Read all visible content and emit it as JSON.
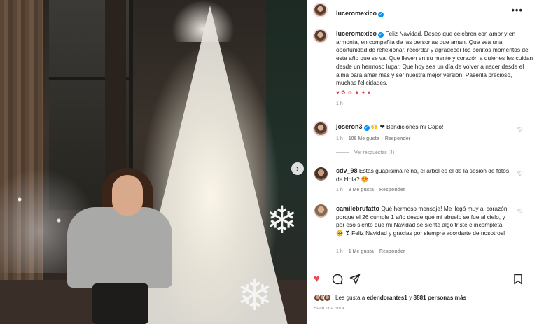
{
  "post_author": {
    "username": "luceromexico",
    "more_label": "•••"
  },
  "caption": {
    "username": "luceromexico",
    "text": "Feliz Navidad. Deseo que celebren con amor y en armonía, en compañía de las personas que aman. Que sea una oportunidad de reflexionar, recordar y agradecer los bonitos momentos de este año que se va. Que lleven en su mente y corazón a quienes les cuidan desde un hermoso lugar. Que hoy sea un día de volver a nacer desde el alma para amar más y ser nuestra mejor versión. Pásenla precioso, muchas felicidades.",
    "emojis": "♥ ✿ ☺ ★ ✦ ♥",
    "time": "1 h"
  },
  "comments": [
    {
      "username": "joseron3",
      "text": "🙌 ❤ Bendiciones mi Capo!",
      "time": "1 h",
      "likes": "108 Me gusta",
      "reply": "Responder",
      "view_replies": "Ver respuestas (4)"
    },
    {
      "username": "cdv_98",
      "text": "Estás guapísima reina, el árbol es el de la sesión de fotos de Hola? 😍",
      "time": "1 h",
      "likes": "3 Me gusta",
      "reply": "Responder"
    },
    {
      "username": "camilebrufatto",
      "text": "Qué hermoso mensaje! Me llegó muy al corazón porque el 26 cumple 1 año desde que mi abuelo se fue al cielo, y por eso siento que mi Navidad se siente algo triste e incompleta 🥺 ❣ Feliz Navidad y gracias por siempre acordarte de nosotros!",
      "time": "1 h",
      "likes": "1 Me gusta",
      "reply": "Responder"
    }
  ],
  "actions": {
    "like_icon": "heart-filled-icon",
    "comment_icon": "comment-icon",
    "share_icon": "share-icon",
    "save_icon": "bookmark-icon",
    "accent_color": "#ed4956"
  },
  "likes_summary": {
    "prefix": "Les gusta a ",
    "first_user": "edendorantes1",
    "middle": " y ",
    "count": "8881 personas más"
  },
  "posted_ago": "Hace una hora"
}
